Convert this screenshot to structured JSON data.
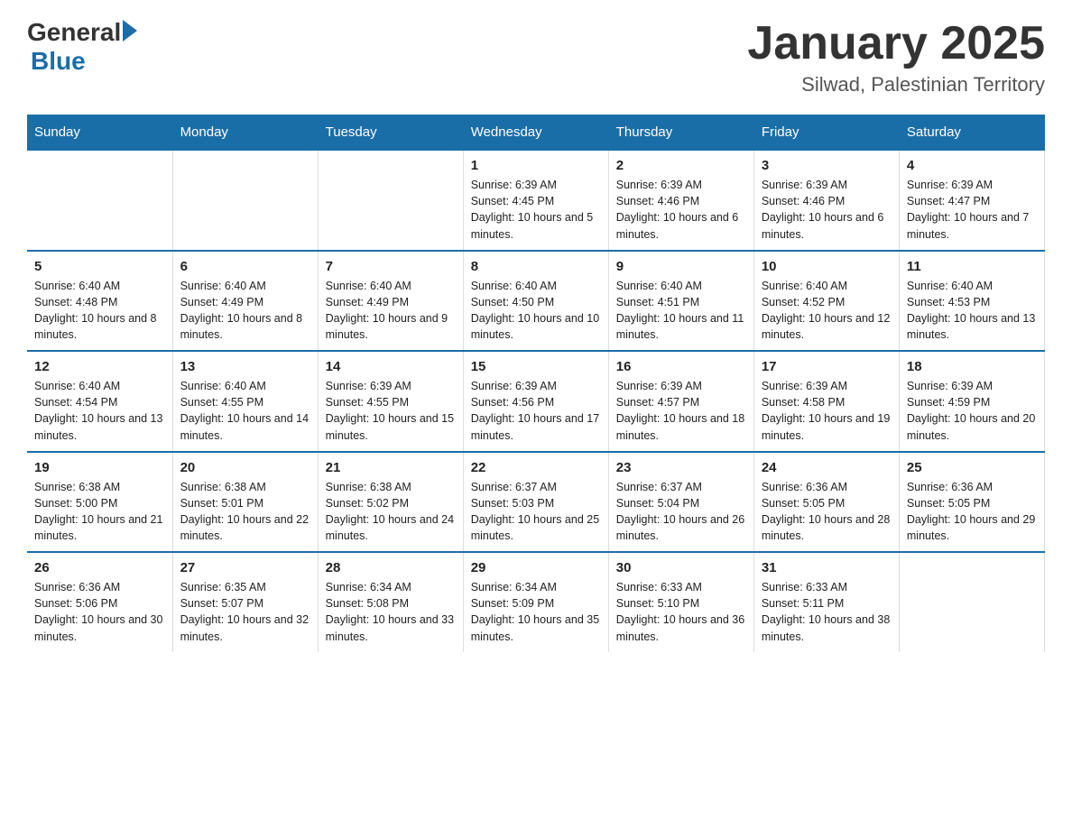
{
  "logo": {
    "general_text": "General",
    "blue_text": "Blue"
  },
  "title": "January 2025",
  "subtitle": "Silwad, Palestinian Territory",
  "days_of_week": [
    "Sunday",
    "Monday",
    "Tuesday",
    "Wednesday",
    "Thursday",
    "Friday",
    "Saturday"
  ],
  "weeks": [
    [
      {
        "day": "",
        "info": ""
      },
      {
        "day": "",
        "info": ""
      },
      {
        "day": "",
        "info": ""
      },
      {
        "day": "1",
        "info": "Sunrise: 6:39 AM\nSunset: 4:45 PM\nDaylight: 10 hours and 5 minutes."
      },
      {
        "day": "2",
        "info": "Sunrise: 6:39 AM\nSunset: 4:46 PM\nDaylight: 10 hours and 6 minutes."
      },
      {
        "day": "3",
        "info": "Sunrise: 6:39 AM\nSunset: 4:46 PM\nDaylight: 10 hours and 6 minutes."
      },
      {
        "day": "4",
        "info": "Sunrise: 6:39 AM\nSunset: 4:47 PM\nDaylight: 10 hours and 7 minutes."
      }
    ],
    [
      {
        "day": "5",
        "info": "Sunrise: 6:40 AM\nSunset: 4:48 PM\nDaylight: 10 hours and 8 minutes."
      },
      {
        "day": "6",
        "info": "Sunrise: 6:40 AM\nSunset: 4:49 PM\nDaylight: 10 hours and 8 minutes."
      },
      {
        "day": "7",
        "info": "Sunrise: 6:40 AM\nSunset: 4:49 PM\nDaylight: 10 hours and 9 minutes."
      },
      {
        "day": "8",
        "info": "Sunrise: 6:40 AM\nSunset: 4:50 PM\nDaylight: 10 hours and 10 minutes."
      },
      {
        "day": "9",
        "info": "Sunrise: 6:40 AM\nSunset: 4:51 PM\nDaylight: 10 hours and 11 minutes."
      },
      {
        "day": "10",
        "info": "Sunrise: 6:40 AM\nSunset: 4:52 PM\nDaylight: 10 hours and 12 minutes."
      },
      {
        "day": "11",
        "info": "Sunrise: 6:40 AM\nSunset: 4:53 PM\nDaylight: 10 hours and 13 minutes."
      }
    ],
    [
      {
        "day": "12",
        "info": "Sunrise: 6:40 AM\nSunset: 4:54 PM\nDaylight: 10 hours and 13 minutes."
      },
      {
        "day": "13",
        "info": "Sunrise: 6:40 AM\nSunset: 4:55 PM\nDaylight: 10 hours and 14 minutes."
      },
      {
        "day": "14",
        "info": "Sunrise: 6:39 AM\nSunset: 4:55 PM\nDaylight: 10 hours and 15 minutes."
      },
      {
        "day": "15",
        "info": "Sunrise: 6:39 AM\nSunset: 4:56 PM\nDaylight: 10 hours and 17 minutes."
      },
      {
        "day": "16",
        "info": "Sunrise: 6:39 AM\nSunset: 4:57 PM\nDaylight: 10 hours and 18 minutes."
      },
      {
        "day": "17",
        "info": "Sunrise: 6:39 AM\nSunset: 4:58 PM\nDaylight: 10 hours and 19 minutes."
      },
      {
        "day": "18",
        "info": "Sunrise: 6:39 AM\nSunset: 4:59 PM\nDaylight: 10 hours and 20 minutes."
      }
    ],
    [
      {
        "day": "19",
        "info": "Sunrise: 6:38 AM\nSunset: 5:00 PM\nDaylight: 10 hours and 21 minutes."
      },
      {
        "day": "20",
        "info": "Sunrise: 6:38 AM\nSunset: 5:01 PM\nDaylight: 10 hours and 22 minutes."
      },
      {
        "day": "21",
        "info": "Sunrise: 6:38 AM\nSunset: 5:02 PM\nDaylight: 10 hours and 24 minutes."
      },
      {
        "day": "22",
        "info": "Sunrise: 6:37 AM\nSunset: 5:03 PM\nDaylight: 10 hours and 25 minutes."
      },
      {
        "day": "23",
        "info": "Sunrise: 6:37 AM\nSunset: 5:04 PM\nDaylight: 10 hours and 26 minutes."
      },
      {
        "day": "24",
        "info": "Sunrise: 6:36 AM\nSunset: 5:05 PM\nDaylight: 10 hours and 28 minutes."
      },
      {
        "day": "25",
        "info": "Sunrise: 6:36 AM\nSunset: 5:05 PM\nDaylight: 10 hours and 29 minutes."
      }
    ],
    [
      {
        "day": "26",
        "info": "Sunrise: 6:36 AM\nSunset: 5:06 PM\nDaylight: 10 hours and 30 minutes."
      },
      {
        "day": "27",
        "info": "Sunrise: 6:35 AM\nSunset: 5:07 PM\nDaylight: 10 hours and 32 minutes."
      },
      {
        "day": "28",
        "info": "Sunrise: 6:34 AM\nSunset: 5:08 PM\nDaylight: 10 hours and 33 minutes."
      },
      {
        "day": "29",
        "info": "Sunrise: 6:34 AM\nSunset: 5:09 PM\nDaylight: 10 hours and 35 minutes."
      },
      {
        "day": "30",
        "info": "Sunrise: 6:33 AM\nSunset: 5:10 PM\nDaylight: 10 hours and 36 minutes."
      },
      {
        "day": "31",
        "info": "Sunrise: 6:33 AM\nSunset: 5:11 PM\nDaylight: 10 hours and 38 minutes."
      },
      {
        "day": "",
        "info": ""
      }
    ]
  ]
}
